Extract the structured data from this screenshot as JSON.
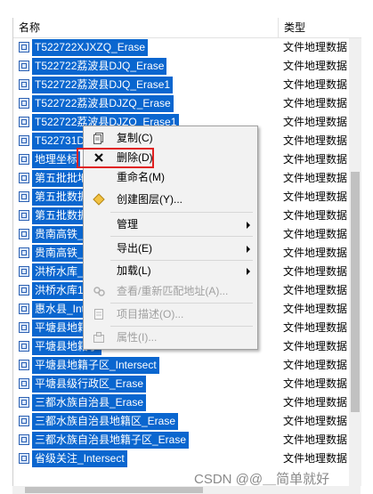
{
  "header": {
    "col_name": "名称",
    "col_type": "类型"
  },
  "rows": [
    {
      "name": "T522722XJXZQ_Erase",
      "type": "文件地理数据"
    },
    {
      "name": "T522722荔波县DJQ_Erase",
      "type": "文件地理数据"
    },
    {
      "name": "T522722荔波县DJQ_Erase1",
      "type": "文件地理数据"
    },
    {
      "name": "T522722荔波县DJZQ_Erase",
      "type": "文件地理数据"
    },
    {
      "name": "T522722荔波县DJZQ_Erase1",
      "type": "文件地理数据"
    },
    {
      "name": "T522731D",
      "type": "文件地理数据"
    },
    {
      "name": "地理坐标",
      "type": "文件地理数据"
    },
    {
      "name": "第五批批地",
      "type": "文件地理数据"
    },
    {
      "name": "第五批数据",
      "type": "文件地理数据"
    },
    {
      "name": "第五批数据",
      "type": "文件地理数据"
    },
    {
      "name": "贵南高铁_B",
      "type": "文件地理数据"
    },
    {
      "name": "贵南高铁_ 三",
      "type": "文件地理数据"
    },
    {
      "name": "洪桥水库_",
      "type": "文件地理数据"
    },
    {
      "name": "洪桥水库1",
      "type": "文件地理数据"
    },
    {
      "name": "惠水县_Int",
      "type": "文件地理数据"
    },
    {
      "name": "平塘县地籍",
      "type": "文件地理数据"
    },
    {
      "name": "平塘县地籍子",
      "type": "文件地理数据"
    },
    {
      "name": "平塘县地籍子区_Intersect",
      "type": "文件地理数据"
    },
    {
      "name": "平塘县级行政区_Erase",
      "type": "文件地理数据"
    },
    {
      "name": "三都水族自治县_Erase",
      "type": "文件地理数据"
    },
    {
      "name": "三都水族自治县地籍区_Erase",
      "type": "文件地理数据"
    },
    {
      "name": "三都水族自治县地籍子区_Erase",
      "type": "文件地理数据"
    },
    {
      "name": "省级关注_Intersect",
      "type": "文件地理数据"
    }
  ],
  "context_menu": {
    "items": [
      {
        "label": "复制(C)",
        "icon": "copy-icon",
        "enabled": true,
        "submenu": false
      },
      {
        "label": "删除(D)",
        "icon": "delete-x-icon",
        "enabled": true,
        "submenu": false
      },
      {
        "label": "重命名(M)",
        "icon": "",
        "enabled": true,
        "submenu": false
      },
      {
        "label": "创建图层(Y)...",
        "icon": "layer-diamond-icon",
        "enabled": true,
        "submenu": false
      },
      {
        "label": "管理",
        "icon": "",
        "enabled": true,
        "submenu": true
      },
      {
        "label": "导出(E)",
        "icon": "",
        "enabled": true,
        "submenu": true
      },
      {
        "label": "加载(L)",
        "icon": "",
        "enabled": true,
        "submenu": true
      },
      {
        "label": "查看/重新匹配地址(A)...",
        "icon": "address-icon",
        "enabled": false,
        "submenu": false
      },
      {
        "label": "项目描述(O)...",
        "icon": "description-icon",
        "enabled": false,
        "submenu": false
      },
      {
        "label": "属性(I)...",
        "icon": "properties-icon",
        "enabled": false,
        "submenu": false
      }
    ]
  },
  "highlight_color": "#e02020",
  "selection_color": "#0a66cf",
  "watermark": "CSDN @@＿简单就好"
}
